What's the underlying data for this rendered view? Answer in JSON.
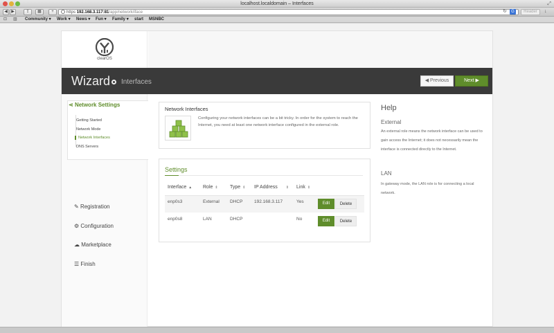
{
  "window": {
    "title": "localhost.localdomain – Interfaces"
  },
  "toolbar": {
    "address": {
      "scheme": "https",
      "host": "192.168.3.117:81",
      "path": "/app/network/iface"
    },
    "reader_label": "Reader"
  },
  "bookmarks": [
    {
      "label": "Community",
      "caret": "▾"
    },
    {
      "label": "Work",
      "caret": "▾"
    },
    {
      "label": "News",
      "caret": "▾"
    },
    {
      "label": "Fun",
      "caret": "▾"
    },
    {
      "label": "Family",
      "caret": "▾"
    },
    {
      "label": "start",
      "caret": ""
    },
    {
      "label": "MSNBC",
      "caret": ""
    }
  ],
  "brand": {
    "logo_text": "clearOS"
  },
  "banner": {
    "title": "Wizard",
    "subtitle": "Interfaces",
    "prev_label": "Previous",
    "next_label": "Next"
  },
  "sidebar": {
    "section_title": "Network Settings",
    "subitems": [
      {
        "label": "Getting Started",
        "active": false
      },
      {
        "label": "Network Mode",
        "active": false
      },
      {
        "label": "Network Interfaces",
        "active": true
      },
      {
        "label": "DNS Servers",
        "active": false
      }
    ],
    "items": [
      {
        "label": "Registration",
        "icon": "pencil-icon"
      },
      {
        "label": "Configuration",
        "icon": "gears-icon"
      },
      {
        "label": "Marketplace",
        "icon": "cloud-download-icon"
      },
      {
        "label": "Finish",
        "icon": "list-icon"
      }
    ]
  },
  "network_interfaces": {
    "title": "Network Interfaces",
    "description": "Configuring your network interfaces can be a bit tricky. In order for the system to reach the Internet, you need at least one network interface configured in the external role."
  },
  "settings": {
    "title": "Settings",
    "columns": [
      "Interface",
      "Role",
      "Type",
      "IP Address",
      "Link"
    ],
    "rows": [
      {
        "interface": "enp0s3",
        "role": "External",
        "type": "DHCP",
        "ip": "192.168.3.117",
        "link": "Yes"
      },
      {
        "interface": "enp0s8",
        "role": "LAN",
        "type": "DHCP",
        "ip": "",
        "link": "No"
      }
    ],
    "edit_label": "Edit",
    "delete_label": "Delete"
  },
  "help": {
    "title": "Help",
    "sections": [
      {
        "heading": "External",
        "text": "An external role means the network interface can be used to gain access the Internet; it does not necessarily mean the interface is connected directly to the Internet."
      },
      {
        "heading": "LAN",
        "text": "In gateway mode, the LAN role is for connecting a local network."
      }
    ]
  },
  "colors": {
    "accent": "#5f8d2b",
    "banner": "#3a3a3a"
  }
}
